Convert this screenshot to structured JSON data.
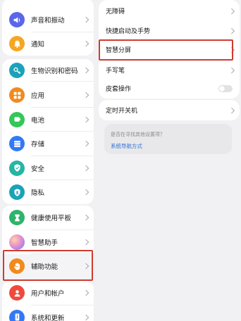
{
  "left_menu": [
    {
      "label": "声音和振动",
      "icon": "speaker-icon",
      "color": "#5b67e8"
    },
    {
      "label": "通知",
      "icon": "bell-icon",
      "color": "#f5a623"
    },
    {
      "label": "生物识别和密码",
      "icon": "key-icon",
      "color": "#1aa3b8"
    },
    {
      "label": "应用",
      "icon": "apps-grid-icon",
      "color": "#f18a1d"
    },
    {
      "label": "电池",
      "icon": "battery-icon",
      "color": "#34c759"
    },
    {
      "label": "存储",
      "icon": "storage-icon",
      "color": "#3478f6"
    },
    {
      "label": "安全",
      "icon": "shield-icon",
      "color": "#25b5a3"
    },
    {
      "label": "隐私",
      "icon": "privacy-icon",
      "color": "#1aa3b8"
    },
    {
      "label": "健康使用平板",
      "icon": "hourglass-icon",
      "color": "#2fb36c"
    },
    {
      "label": "智慧助手",
      "icon": "assistant-orb-icon",
      "color": "#b98cf0"
    },
    {
      "label": "辅助功能",
      "icon": "hand-icon",
      "color": "#f18a1d"
    },
    {
      "label": "用户和帐户",
      "icon": "user-icon",
      "color": "#ef4a3c"
    },
    {
      "label": "系统和更新",
      "icon": "phone-info-icon",
      "color": "#3478f6"
    }
  ],
  "right_menu": {
    "items": [
      {
        "label": "无障碍",
        "control": "chevron"
      },
      {
        "label": "快捷启动及手势",
        "control": "chevron"
      },
      {
        "label": "智慧分屏",
        "control": "chevron"
      },
      {
        "label": "手写笔",
        "control": "chevron"
      },
      {
        "label": "皮套操作",
        "control": "toggle",
        "toggle_on": false
      },
      {
        "label": "定时开关机",
        "control": "chevron"
      }
    ],
    "hint": {
      "question": "是否在寻找其他设置项？",
      "link": "系统导航方式"
    }
  },
  "highlight_color": "#cf3b2f"
}
